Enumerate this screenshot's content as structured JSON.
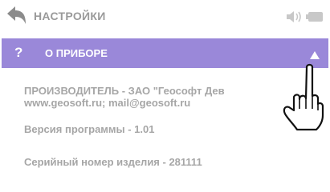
{
  "header": {
    "title": "НАСТРОЙКИ",
    "back_icon": "back-arrow-icon",
    "volume_icon": "speaker-icon",
    "battery_icon": "battery-icon"
  },
  "section": {
    "help_label": "?",
    "title": "О ПРИБОРЕ",
    "collapse_icon": "triangle-up-icon"
  },
  "info": {
    "manufacturer_line1": "ПРОИЗВОДИТЕЛЬ - ЗАО \"Геософт Дев",
    "manufacturer_line2": "www.geosoft.ru; mail@geosoft.ru",
    "version": "Версия программы - 1.01",
    "serial": "Серийный номер изделия - 281111"
  },
  "colors": {
    "section_bar": "#9a88d9",
    "text_grey": "#a6a6a6",
    "title_grey": "#9a9a9a"
  }
}
